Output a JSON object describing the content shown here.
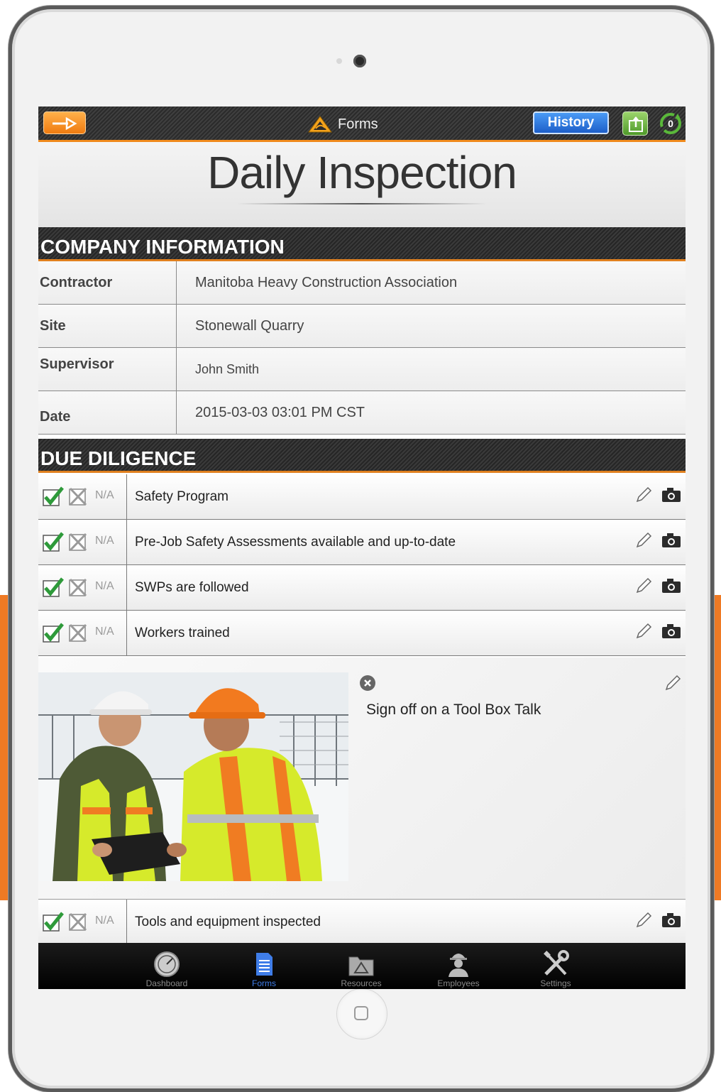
{
  "nav": {
    "title": "Forms",
    "history_label": "History",
    "sync_count": "0"
  },
  "page_title": "Daily Inspection",
  "company_section": {
    "header": "COMPANY INFORMATION",
    "rows": [
      {
        "label": "Contractor",
        "value": "Manitoba Heavy Construction Association"
      },
      {
        "label": "Site",
        "value": "Stonewall Quarry"
      },
      {
        "label": "Supervisor",
        "value": "John Smith"
      },
      {
        "label": "Date",
        "value": "2015-03-03 03:01 PM CST"
      }
    ]
  },
  "diligence_section": {
    "header": "DUE DILIGENCE",
    "na_label": "N/A",
    "items": [
      {
        "label": "Safety Program",
        "checked": true
      },
      {
        "label": "Pre-Job Safety Assessments available and up-to-date",
        "checked": true
      },
      {
        "label": "SWPs are followed",
        "checked": true
      },
      {
        "label": "Workers trained",
        "checked": true
      }
    ],
    "toolbox_talk": "Sign off on a Tool Box Talk",
    "last_item": {
      "label": "Tools and equipment inspected",
      "checked": true
    }
  },
  "tabbar": {
    "tabs": [
      {
        "label": "Dashboard",
        "icon": "dashboard-icon"
      },
      {
        "label": "Forms",
        "icon": "document-icon",
        "active": true
      },
      {
        "label": "Resources",
        "icon": "folder-icon"
      },
      {
        "label": "Employees",
        "icon": "worker-icon"
      },
      {
        "label": "Settings",
        "icon": "tools-icon"
      }
    ]
  },
  "colors": {
    "accent_orange": "#f08a1d",
    "history_blue": "#2a6fdb",
    "check_green": "#2e9a3a",
    "active_tab": "#3f7de8"
  }
}
